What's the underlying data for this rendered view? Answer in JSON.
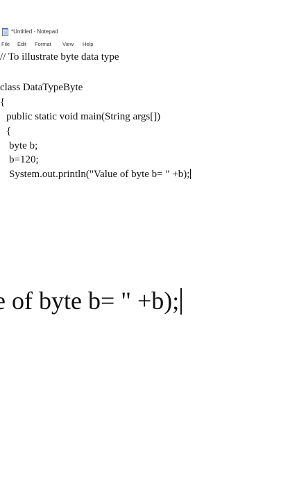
{
  "window": {
    "title": "*Untitled - Notepad",
    "icon": "notepad-icon"
  },
  "menu": {
    "file": "File",
    "edit": "Edit",
    "format": "Format",
    "view": "View",
    "help": "Help"
  },
  "editor": {
    "lines": [
      "// To illustrate byte data type",
      "class DataTypeByte",
      "{",
      "public static void main(String args[])",
      "{",
      "byte b;",
      "b=120;",
      "System.out.println(\"Value of byte b= \" +b);"
    ]
  },
  "zoom": {
    "text": "e of byte b= \" +b);"
  }
}
